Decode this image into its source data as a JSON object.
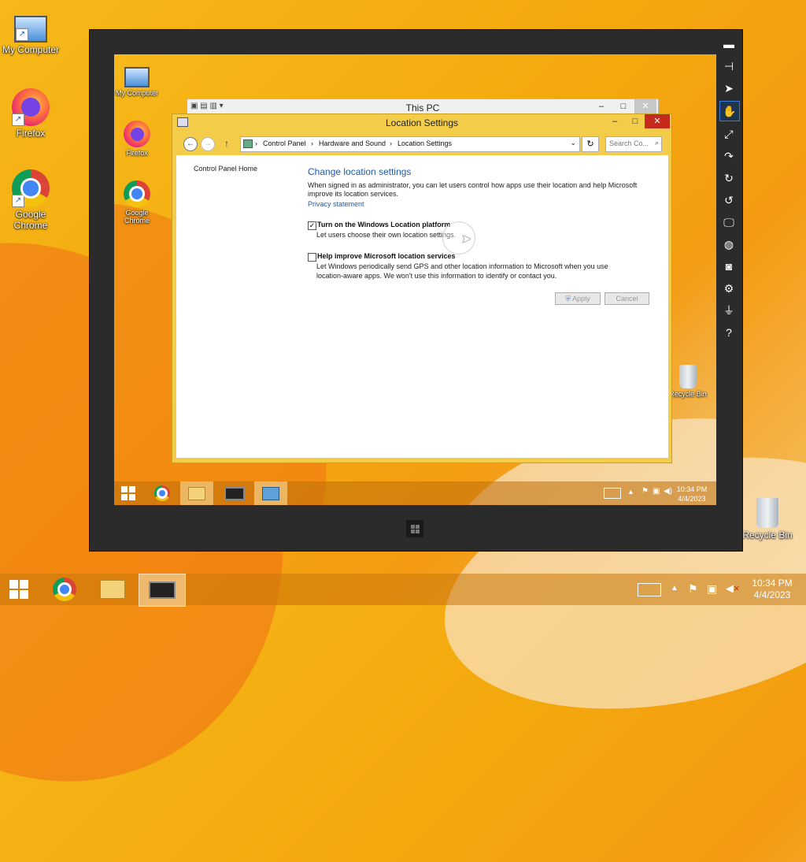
{
  "desktop": {
    "icons": [
      {
        "label": "My Computer"
      },
      {
        "label": "Firefox"
      },
      {
        "label": "Google Chrome"
      },
      {
        "label": "Recycle Bin"
      }
    ]
  },
  "remote": {
    "icons": [
      {
        "label": "My Computer"
      },
      {
        "label": "Firefox"
      },
      {
        "label": "Google Chrome"
      },
      {
        "label": "Recycle Bin"
      }
    ],
    "back_window_title": "This PC",
    "window": {
      "title": "Location Settings",
      "breadcrumb": [
        "Control Panel",
        "Hardware and Sound",
        "Location Settings"
      ],
      "search_placeholder": "Search Co...",
      "left_link": "Control Panel Home",
      "heading": "Change location settings",
      "intro": "When signed in as administrator, you can let users control how apps use their location and help Microsoft improve its location services.",
      "privacy_link": "Privacy statement",
      "option1": {
        "label": "Turn on the Windows Location platform",
        "desc": "Let users choose their own location settings.",
        "checked": true
      },
      "option2": {
        "label": "Help improve Microsoft location services",
        "desc": "Let Windows periodically send GPS and other location information to Microsoft when you use location-aware apps. We won't use this information to identify or contact you.",
        "checked": false
      },
      "apply_label": "Apply",
      "cancel_label": "Cancel"
    },
    "tray": {
      "time": "10:34 PM",
      "date": "4/4/2023"
    }
  },
  "tray": {
    "time": "10:34 PM",
    "date": "4/4/2023"
  },
  "colors": {
    "accent": "#1e5aa8",
    "close": "#c42b1c"
  }
}
